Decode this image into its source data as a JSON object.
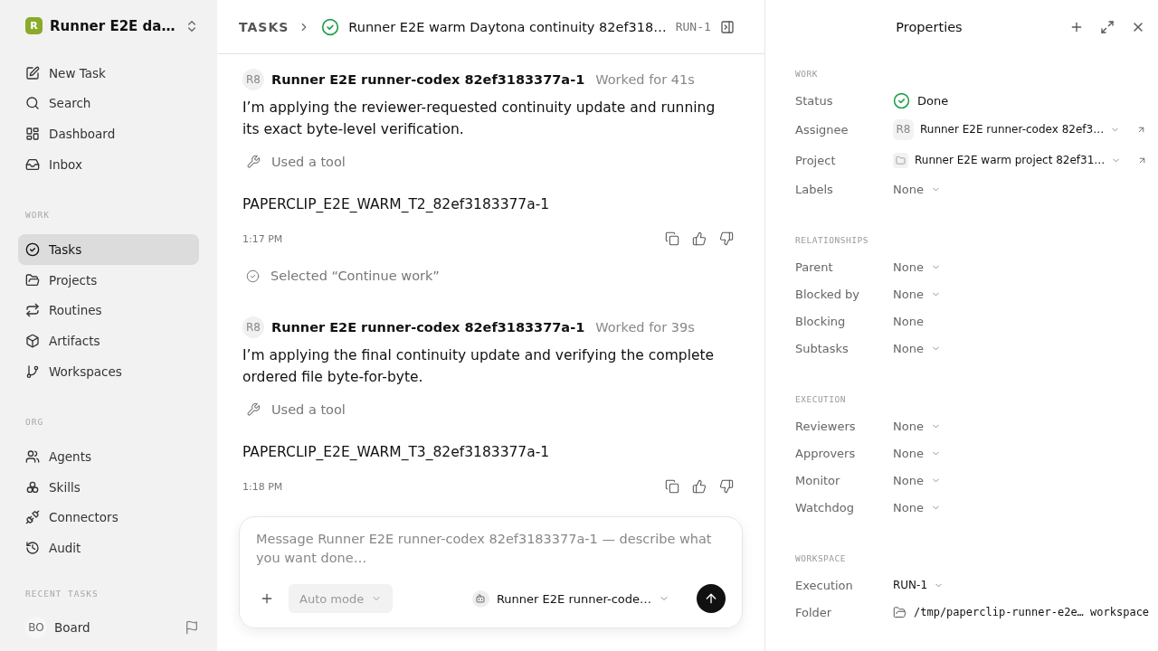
{
  "sidebar": {
    "workspace": {
      "logo_letter": "R",
      "name": "Runner E2E da…"
    },
    "groups": [
      {
        "items": [
          {
            "label": "New Task",
            "selected": false
          },
          {
            "label": "Search",
            "selected": false
          },
          {
            "label": "Dashboard",
            "selected": false
          },
          {
            "label": "Inbox",
            "selected": false
          }
        ]
      },
      {
        "title": "WORK",
        "items": [
          {
            "label": "Tasks",
            "selected": true
          },
          {
            "label": "Projects",
            "selected": false
          },
          {
            "label": "Routines",
            "selected": false
          },
          {
            "label": "Artifacts",
            "selected": false
          },
          {
            "label": "Workspaces",
            "selected": false
          }
        ]
      },
      {
        "title": "ORG",
        "items": [
          {
            "label": "Agents",
            "selected": false
          },
          {
            "label": "Skills",
            "selected": false
          },
          {
            "label": "Connectors",
            "selected": false
          },
          {
            "label": "Audit",
            "selected": false
          }
        ]
      }
    ],
    "recent_title": "RECENT TASKS",
    "footer": {
      "initials": "BO",
      "label": "Board"
    }
  },
  "header": {
    "breadcrumb": "TASKS",
    "title": "Runner E2E warm Daytona continuity 82ef318…",
    "run": "RUN-1"
  },
  "thread": [
    {
      "kind": "message",
      "avatar": "R8",
      "author": "Runner E2E runner-codex 82ef3183377a-1",
      "duration": "Worked for 41s",
      "text": "I’m applying the reviewer-requested continuity update and running its exact byte-level verification.",
      "tool": "Used a tool",
      "output": "PAPERCLIP_E2E_WARM_T2_82ef3183377a-1",
      "time": "1:17 PM"
    },
    {
      "kind": "selection",
      "text": "Selected “Continue work”"
    },
    {
      "kind": "message",
      "avatar": "R8",
      "author": "Runner E2E runner-codex 82ef3183377a-1",
      "duration": "Worked for 39s",
      "text": "I’m applying the final continuity update and verifying the complete ordered file byte-for-byte.",
      "tool": "Used a tool",
      "output": "PAPERCLIP_E2E_WARM_T3_82ef3183377a-1",
      "time": "1:18 PM"
    }
  ],
  "composer": {
    "placeholder": "Message Runner E2E runner-codex 82ef3183377a-1 — describe what you want done…",
    "mode": "Auto mode",
    "agent": "Runner E2E runner-code…"
  },
  "properties": {
    "title": "Properties",
    "sections": [
      {
        "title": "WORK",
        "rows": [
          {
            "label": "Status",
            "kind": "status",
            "value": "Done"
          },
          {
            "label": "Assignee",
            "kind": "agent",
            "avatar": "R8",
            "value": "Runner E2E runner-codex 82ef3…",
            "link": true
          },
          {
            "label": "Project",
            "kind": "project",
            "value": "Runner E2E warm project 82ef31…",
            "link": true
          },
          {
            "label": "Labels",
            "kind": "select",
            "value": "None"
          }
        ]
      },
      {
        "title": "RELATIONSHIPS",
        "rows": [
          {
            "label": "Parent",
            "kind": "select",
            "value": "None"
          },
          {
            "label": "Blocked by",
            "kind": "select",
            "value": "None"
          },
          {
            "label": "Blocking",
            "kind": "plain",
            "value": "None"
          },
          {
            "label": "Subtasks",
            "kind": "select",
            "value": "None"
          }
        ]
      },
      {
        "title": "EXECUTION",
        "rows": [
          {
            "label": "Reviewers",
            "kind": "select",
            "value": "None"
          },
          {
            "label": "Approvers",
            "kind": "select",
            "value": "None"
          },
          {
            "label": "Monitor",
            "kind": "select",
            "value": "None"
          },
          {
            "label": "Watchdog",
            "kind": "select",
            "value": "None"
          }
        ]
      },
      {
        "title": "WORKSPACE",
        "rows": [
          {
            "label": "Execution",
            "kind": "run",
            "value": "RUN-1"
          },
          {
            "label": "Folder",
            "kind": "folder",
            "value": "/tmp/paperclip-runner-e2e…",
            "suffix": "workspace"
          }
        ]
      }
    ]
  }
}
